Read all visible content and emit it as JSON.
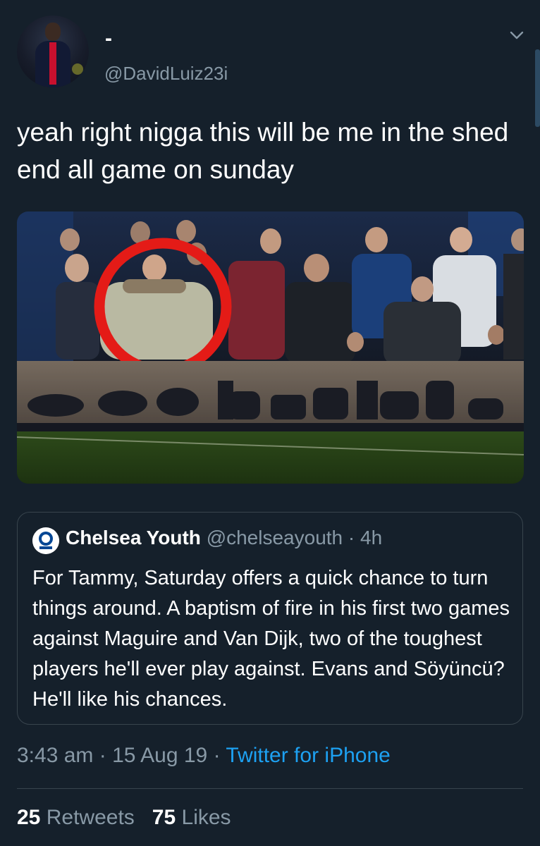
{
  "author": {
    "display_name": "-",
    "handle": "@DavidLuiz23i"
  },
  "tweet": {
    "text": "yeah right nigga this will be me in the shed end all game on sunday"
  },
  "quoted_tweet": {
    "name": "Chelsea Youth",
    "handle": "@chelseayouth",
    "separator": "·",
    "age": "4h",
    "text": "For Tammy, Saturday offers a quick chance to turn things around. A baptism of fire in his first two games against Maguire and Van Dijk, two of the toughest players he'll ever play against. Evans and Söyüncü? He'll like his chances."
  },
  "meta": {
    "time": "3:43 am",
    "sep1": "·",
    "date": "15 Aug 19",
    "sep2": "·",
    "source": "Twitter for iPhone"
  },
  "stats": {
    "retweets_count": "25",
    "retweets_label": "Retweets",
    "likes_count": "75",
    "likes_label": "Likes"
  },
  "colors": {
    "background": "#15202b",
    "secondary_text": "#8899a6",
    "link": "#1da1f2",
    "border": "#38444d",
    "highlight_circle": "#e41b17"
  },
  "icons": [
    "chevron-down-icon",
    "chelsea-crest-icon"
  ]
}
